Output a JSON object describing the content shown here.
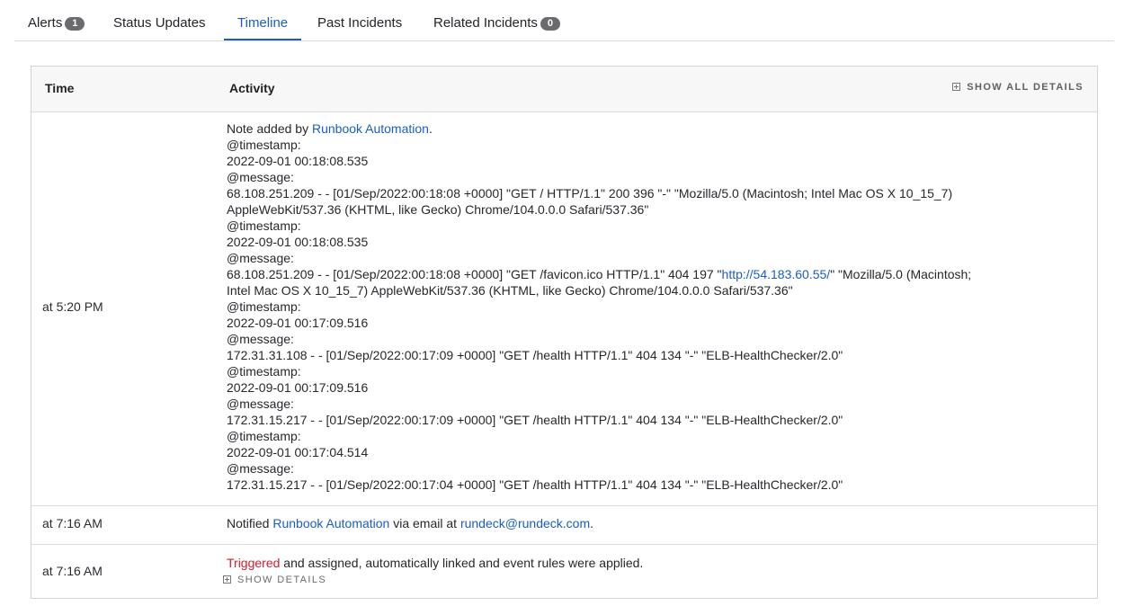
{
  "tabs": [
    {
      "label": "Alerts",
      "badge": "1"
    },
    {
      "label": "Status Updates"
    },
    {
      "label": "Timeline"
    },
    {
      "label": "Past Incidents"
    },
    {
      "label": "Related Incidents",
      "badge": "0"
    }
  ],
  "table": {
    "col_time": "Time",
    "col_activity": "Activity",
    "show_all_details": "SHOW ALL DETAILS"
  },
  "rows": [
    {
      "time": "at 5:20 PM",
      "note_prefix": "Note added by ",
      "note_author": "Runbook Automation",
      "note_suffix": ".",
      "lines": [
        "@timestamp:",
        "2022-09-01 00:18:08.535",
        "@message:",
        "68.108.251.209 - - [01/Sep/2022:00:18:08 +0000] \"GET / HTTP/1.1\" 200 396 \"-\" \"Mozilla/5.0 (Macintosh; Intel Mac OS X 10_15_7)",
        "AppleWebKit/537.36 (KHTML, like Gecko) Chrome/104.0.0.0 Safari/537.36\"",
        "@timestamp:",
        "2022-09-01 00:18:08.535",
        "@message:"
      ],
      "favicon_pre": "68.108.251.209 - - [01/Sep/2022:00:18:08 +0000] \"GET /favicon.ico HTTP/1.1\" 404 197 \"",
      "favicon_link": "http://54.183.60.55/",
      "favicon_post": "\" \"Mozilla/5.0 (Macintosh;",
      "lines2": [
        "Intel Mac OS X 10_15_7) AppleWebKit/537.36 (KHTML, like Gecko) Chrome/104.0.0.0 Safari/537.36\"",
        "@timestamp:",
        "2022-09-01 00:17:09.516",
        "@message:",
        "172.31.31.108 - - [01/Sep/2022:00:17:09 +0000] \"GET /health HTTP/1.1\" 404 134 \"-\" \"ELB-HealthChecker/2.0\"",
        "@timestamp:",
        "2022-09-01 00:17:09.516",
        "@message:",
        "172.31.15.217 - - [01/Sep/2022:00:17:09 +0000] \"GET /health HTTP/1.1\" 404 134 \"-\" \"ELB-HealthChecker/2.0\"",
        "@timestamp:",
        "2022-09-01 00:17:04.514",
        "@message:",
        "172.31.15.217 - - [01/Sep/2022:00:17:04 +0000] \"GET /health HTTP/1.1\" 404 134 \"-\" \"ELB-HealthChecker/2.0\""
      ]
    },
    {
      "time": "at 7:16 AM",
      "prefix": "Notified ",
      "actor": "Runbook Automation",
      "middle": " via email at ",
      "email": "rundeck@rundeck.com",
      "suffix": "."
    },
    {
      "time": "at 7:16 AM",
      "triggered": "Triggered",
      "rest": " and assigned, automatically linked and event rules were applied.",
      "show_details": "SHOW DETAILS"
    }
  ],
  "colors": {
    "accent": "#1a5dc8",
    "triggered": "#d0202c"
  }
}
